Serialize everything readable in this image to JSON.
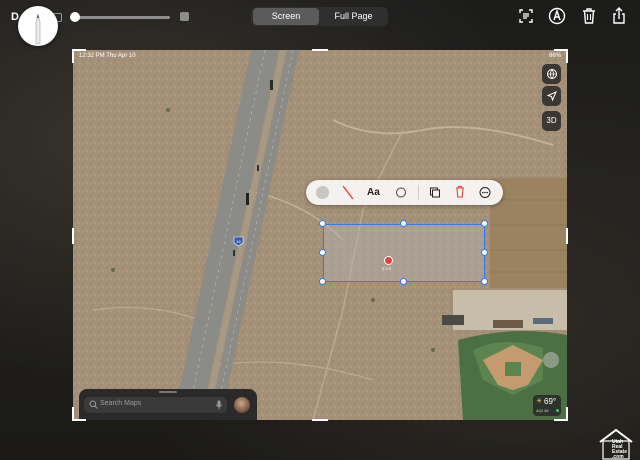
{
  "toolbar": {
    "done_label": "D",
    "tabs": [
      {
        "label": "Screen",
        "selected": true
      },
      {
        "label": "Full Page",
        "selected": false
      }
    ],
    "icons": [
      "text-recognition-icon",
      "markup-icon",
      "trash-icon",
      "share-icon"
    ]
  },
  "screenshot": {
    "status_time": "12:32 PM  Thu Apr 10",
    "status_battery": "86%",
    "map_controls": {
      "globe": "globe-icon",
      "location": "location-arrow-icon",
      "mode_3d": "3D"
    },
    "highway_shield": "15",
    "markup_bar": {
      "text_tool": "Aa",
      "tools": [
        "color-swatch",
        "no-stroke",
        "text",
        "shape",
        "duplicate",
        "delete",
        "more"
      ]
    },
    "pin_label": "9 9 9",
    "search": {
      "placeholder": "Search Maps"
    },
    "weather": {
      "temp": "69°",
      "aqi": "AQI 48"
    }
  },
  "watermark": {
    "line1": "Utah",
    "line2": "Real",
    "line3": "Estate",
    "line4": ".com"
  },
  "colors": {
    "accent": "#2f7cf6",
    "delete": "#e0453d",
    "sun": "#f7c33b",
    "aqi_good": "#45c45e"
  }
}
